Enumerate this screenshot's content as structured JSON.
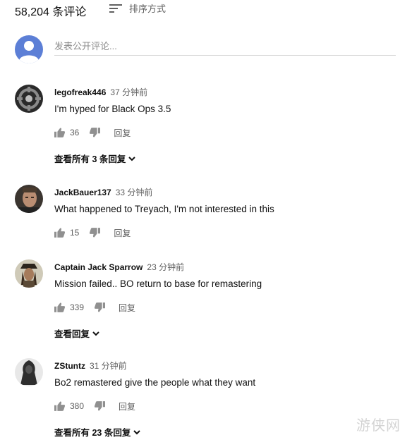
{
  "header": {
    "comment_count": "58,204 条评论",
    "sort_label": "排序方式",
    "sort_icon": "sort-icon"
  },
  "composer": {
    "placeholder": "发表公开评论...",
    "avatar_icon": "user-avatar-icon",
    "avatar_color": "#5c7fd6"
  },
  "comments": [
    {
      "author": "legofreak446",
      "time": "37 分钟前",
      "text": "I'm hyped for Black Ops 3.5",
      "likes": "36",
      "reply_label": "回复",
      "view_replies": "查看所有 3 条回复"
    },
    {
      "author": "JackBauer137",
      "time": "33 分钟前",
      "text": "What happened to Treyach, I'm not interested in this",
      "likes": "15",
      "reply_label": "回复"
    },
    {
      "author": "Captain Jack Sparrow",
      "time": "23 分钟前",
      "text": "Mission failed.. BO return to base for remastering",
      "likes": "339",
      "reply_label": "回复",
      "view_replies": "查看回复"
    },
    {
      "author": "ZStuntz",
      "time": "31 分钟前",
      "text": "Bo2 remastered give the people what they want",
      "likes": "380",
      "reply_label": "回复",
      "view_replies": "查看所有 23 条回复"
    }
  ],
  "watermark": "游侠网",
  "icons": {
    "like": "thumbs-up-icon",
    "dislike": "thumbs-down-icon",
    "expand": "chevron-down-icon"
  },
  "colors": {
    "secondary_text": "#606060",
    "primary_text": "#0f0f0f",
    "divider": "#d6d6d6"
  }
}
